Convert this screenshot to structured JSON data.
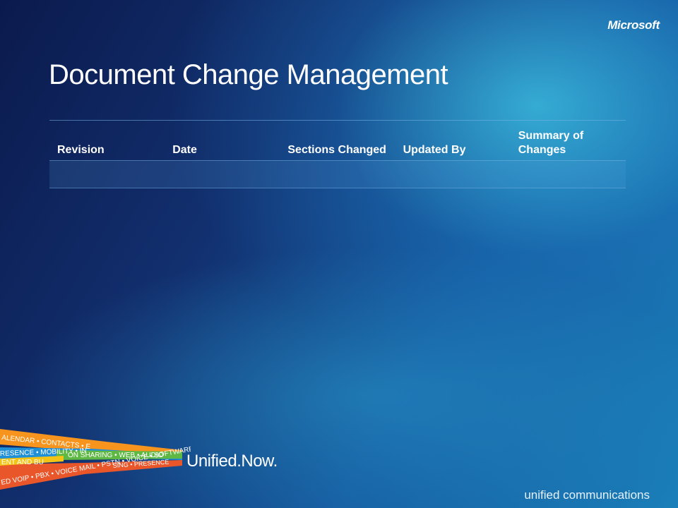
{
  "brand": {
    "logo": "Microsoft"
  },
  "slide": {
    "title": "Document Change Management"
  },
  "table": {
    "headers": [
      "Revision",
      "Date",
      "Sections Changed",
      "Updated By",
      "Summary of Changes"
    ],
    "rows": [
      [
        "",
        "",
        "",
        "",
        ""
      ]
    ]
  },
  "ribbon": {
    "bands": [
      "ALENDAR • CONTACTS • E",
      "RESENCE • MOBILITY • IN",
      "ON SHARING • WEB • AUDIO",
      "ENT AND BU",
      "ED VOIP • PBX • VOICE MAIL • PSTN • VOICE • SOFTWARE",
      "SING • PRESENCE"
    ],
    "colors": {
      "orange": "#f7941d",
      "blue": "#1f8fd6",
      "green": "#5fb843",
      "red": "#e8562a",
      "yellow": "#f3c316"
    }
  },
  "tagline": "Unified.Now.",
  "footer": "unified communications"
}
